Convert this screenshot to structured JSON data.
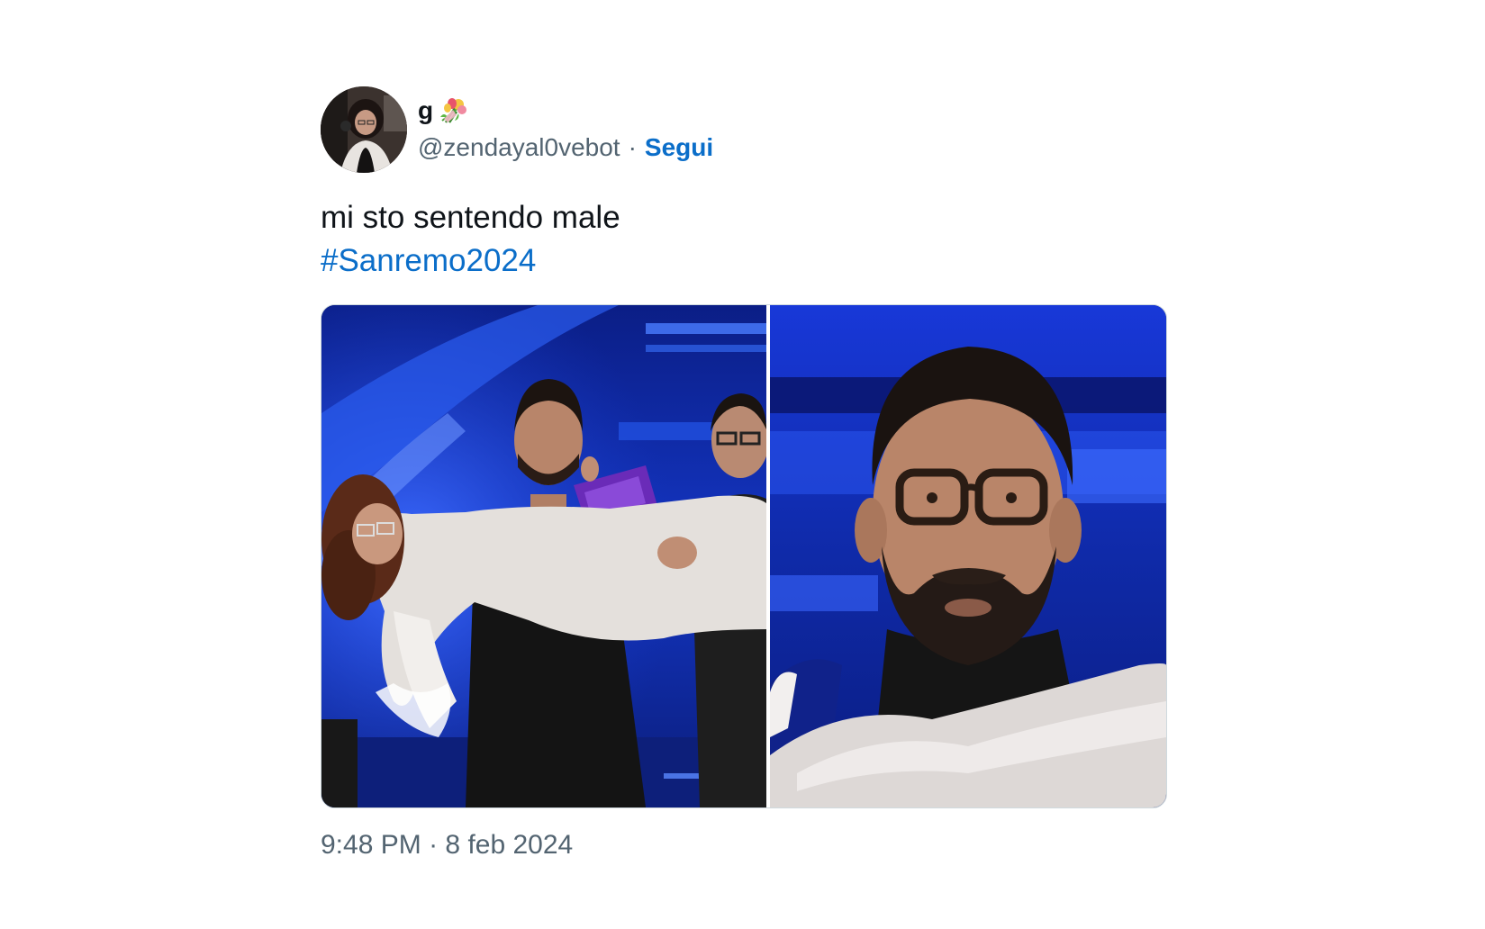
{
  "tweet": {
    "author": {
      "name": "g",
      "name_emoji": "flower-bouquet-icon",
      "handle": "@zendayal0vebot",
      "separator": "·",
      "follow_label": "Segui"
    },
    "text_line": "mi sto sentendo male",
    "hashtag": "#Sanremo2024",
    "media": {
      "count": 2,
      "items": [
        "photo-stage-lift",
        "photo-man-glasses-closeup"
      ]
    },
    "time": "9:48 PM",
    "time_separator": "·",
    "date": "8 feb 2024"
  },
  "colors": {
    "link_blue": "#0b6ec9",
    "text_primary": "#0f1419",
    "text_secondary": "#536471",
    "stage_blue": "#1a3fd6"
  }
}
